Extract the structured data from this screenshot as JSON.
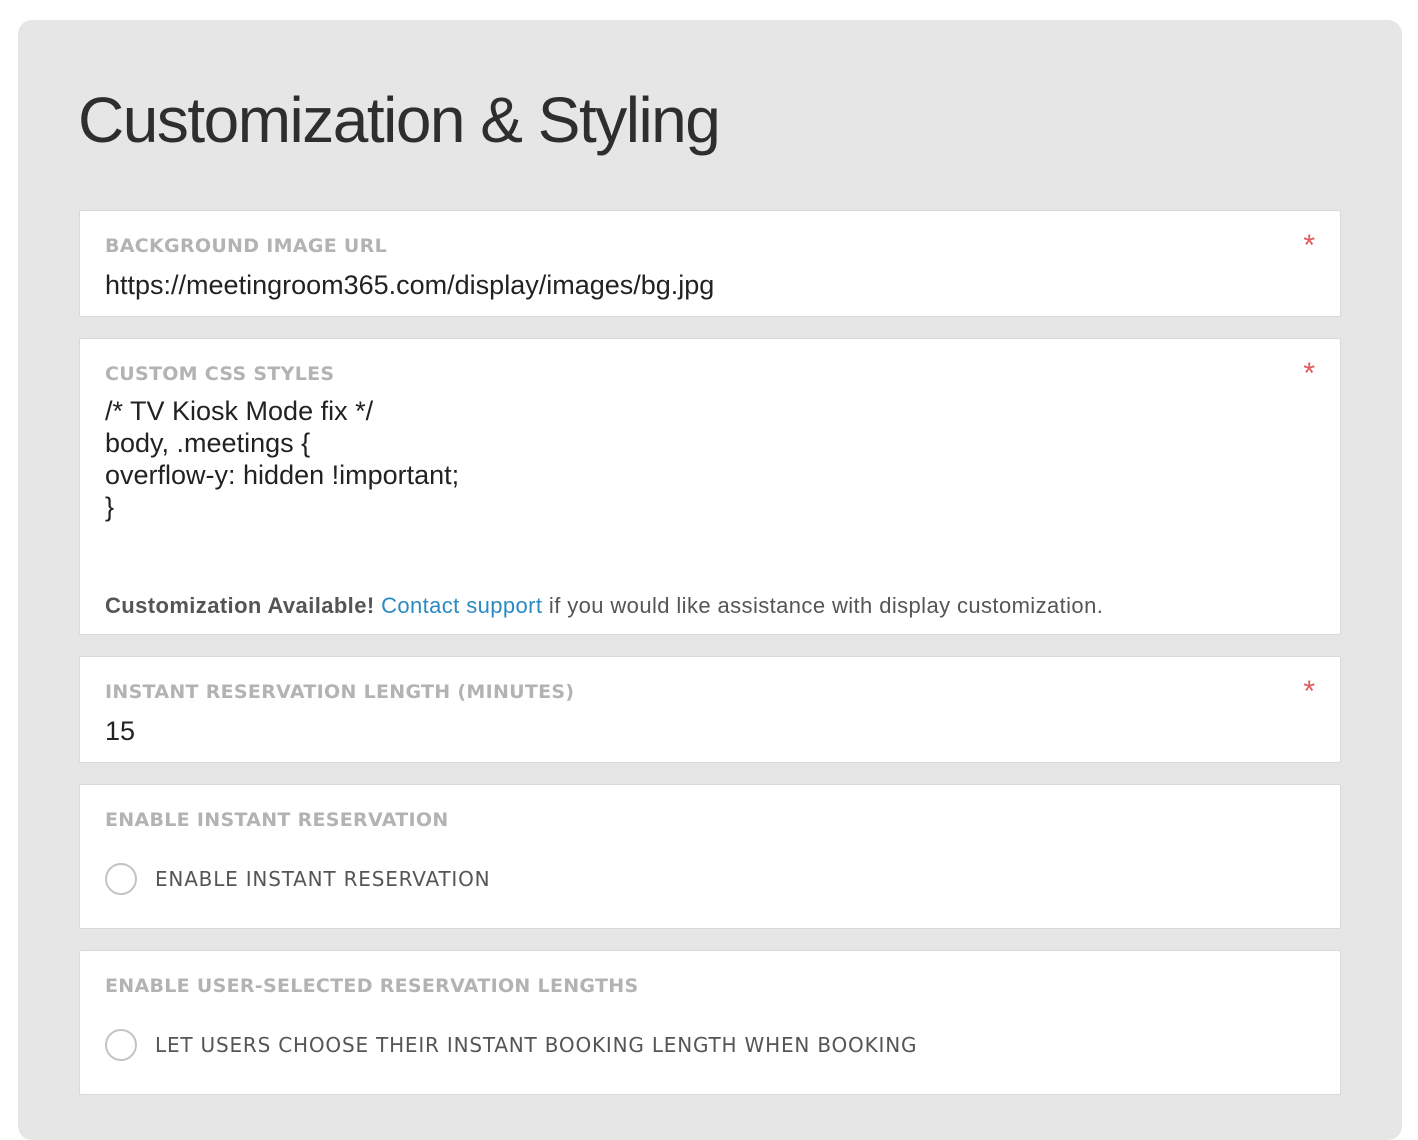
{
  "title": "Customization & Styling",
  "fields": {
    "background_image": {
      "label": "BACKGROUND IMAGE URL",
      "required_mark": "*",
      "value": "https://meetingroom365.com/display/images/bg.jpg"
    },
    "custom_css": {
      "label": "CUSTOM CSS STYLES",
      "required_mark": "*",
      "value": "/* TV Kiosk Mode fix */\nbody, .meetings {\noverflow-y: hidden !important;\n}",
      "help_bold": "Customization Available!",
      "help_link": "Contact support",
      "help_rest": " if you would like assistance with display customization."
    },
    "instant_length": {
      "label": "INSTANT RESERVATION LENGTH (MINUTES)",
      "required_mark": "*",
      "value": "15"
    },
    "enable_instant": {
      "label": "ENABLE INSTANT RESERVATION",
      "option_label": "ENABLE INSTANT RESERVATION",
      "checked": false
    },
    "user_selected_lengths": {
      "label": "ENABLE USER-SELECTED RESERVATION LENGTHS",
      "option_label": "LET USERS CHOOSE THEIR INSTANT BOOKING LENGTH WHEN BOOKING",
      "checked": false
    }
  },
  "colors": {
    "panel_bg": "#e6e6e6",
    "label": "#b3b3b3",
    "required": "#e05a5a",
    "link": "#2b8ac4"
  }
}
